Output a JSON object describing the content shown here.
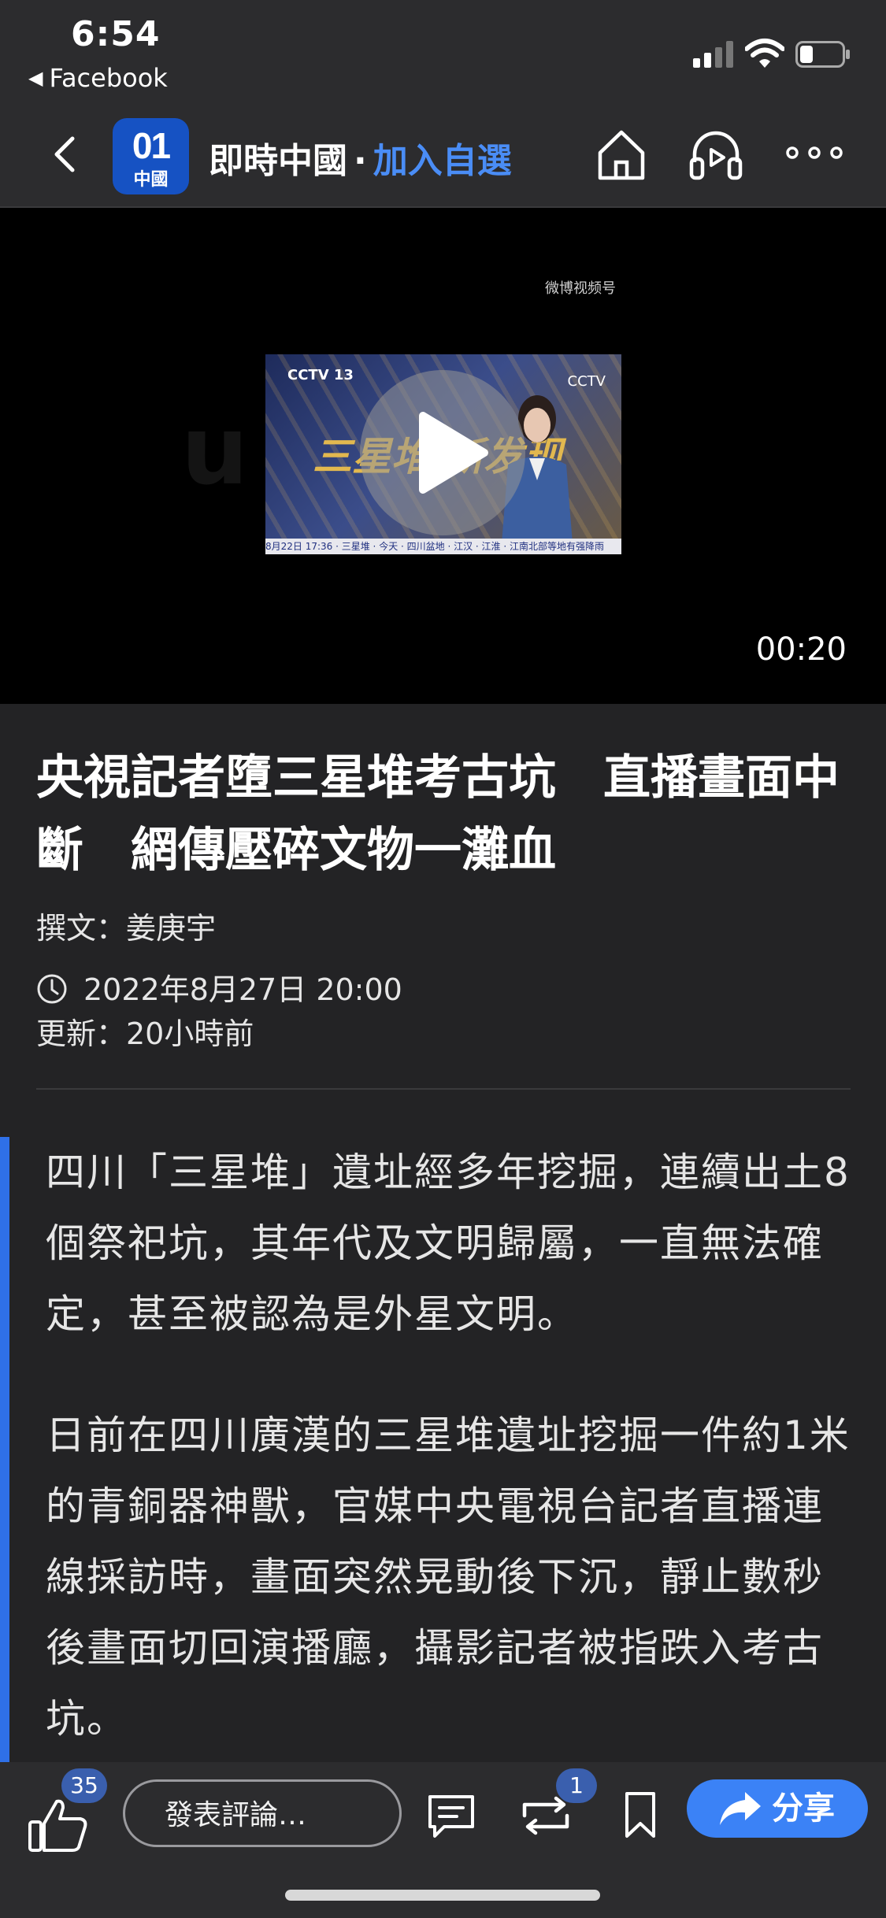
{
  "status_bar": {
    "time": "6:54",
    "back_app": "Facebook"
  },
  "nav": {
    "logo_main": "01",
    "logo_sub": "中國",
    "channel_name": "即時中國",
    "separator": "·",
    "follow_label": "加入自選"
  },
  "video": {
    "duration": "00:20",
    "thumb_cctv": "CCTV 13",
    "thumb_title_art": "三星堆 新发现",
    "thumb_ticker": "8月22日 17:36 · 三星堆 · 今天 · 四川盆地 · 江汉 · 江淮 · 江南北部等地有强降雨",
    "weibo_mark": "微博视频号",
    "watermark": "uso"
  },
  "article": {
    "title": "央視記者墮三星堆考古坑　直播畫面中斷　網傳壓碎文物一灘血",
    "author": "撰文：姜庚宇",
    "date": "2022年8月27日 20:00",
    "updated": "更新：20小時前",
    "paragraphs": [
      "四川「三星堆」遺址經多年挖掘，連續出土8個祭祀坑，其年代及文明歸屬，一直無法確定，甚至被認為是外星文明。",
      "日前在四川廣漢的三星堆遺址挖掘一件約1米的青銅器神獸，官媒中央電視台記者直播連線採訪時，畫面突然晃動後下沉，靜止數秒後畫面切回演播廳，攝影記者被指跌入考古坑。"
    ]
  },
  "toolbar": {
    "like_count": "35",
    "comment_placeholder": "發表評論…",
    "repost_count": "1",
    "share_label": "分享"
  },
  "colors": {
    "accent": "#4a8df6",
    "share_button": "#3b82f6",
    "quote_bar": "#2f70e8",
    "badge": "#3a5fae",
    "logo_bg": "#1652c3"
  },
  "icons": [
    "back-chevron-icon",
    "home-icon",
    "audio-headphone-icon",
    "more-icon",
    "play-icon",
    "clock-icon",
    "thumbs-up-icon",
    "comments-icon",
    "repost-icon",
    "bookmark-icon",
    "share-arrow-icon",
    "signal-icon",
    "wifi-icon",
    "battery-icon"
  ]
}
